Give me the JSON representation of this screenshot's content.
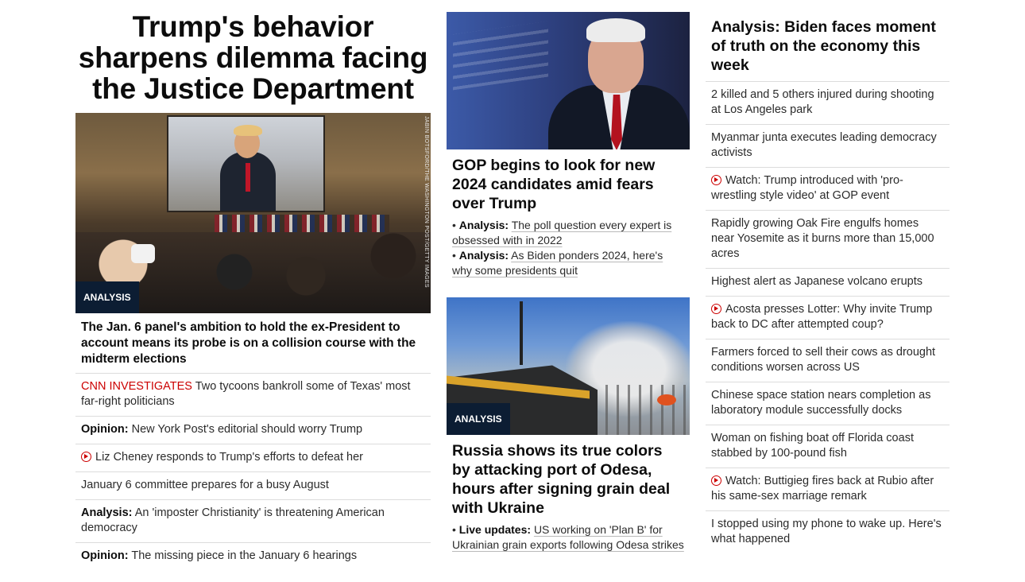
{
  "left": {
    "hero_title": "Trump's behavior sharpens dilemma facing the Justice Department",
    "image_credit": "JABIN BOTSFORD/THE WASHINGTON POST/GETTY IMAGES",
    "badge": "ANALYSIS",
    "card_headline": "The Jan. 6 panel's ambition to hold the ex-President to account means its probe is on a collision course with the midterm elections",
    "items": [
      {
        "tag": "CNN INVESTIGATES",
        "text": " Two tycoons bankroll some of Texas' most far-right politicians"
      },
      {
        "lead": "Opinion:",
        "text": " New York Post's editorial should worry Trump"
      },
      {
        "video": true,
        "text": "Liz Cheney responds to Trump's efforts to defeat her"
      },
      {
        "text": "January 6 committee prepares for a busy August"
      },
      {
        "lead": "Analysis:",
        "text": " An 'imposter Christianity' is threatening American democracy"
      },
      {
        "lead": "Opinion:",
        "text": " The missing piece in the January 6 hearings"
      }
    ]
  },
  "middle": {
    "story1": {
      "headline": "GOP begins to look for new 2024 candidates amid fears over Trump",
      "subs": [
        {
          "bullet": "• ",
          "lead": "Analysis:",
          "text": "The poll question every expert is obsessed with in 2022"
        },
        {
          "bullet": "• ",
          "lead": "Analysis:",
          "text": "As Biden ponders 2024, here's why some presidents quit"
        }
      ]
    },
    "story2": {
      "badge": "ANALYSIS",
      "headline": "Russia shows its true colors by attacking port of Odesa, hours after signing grain deal with Ukraine",
      "subs": [
        {
          "bullet": "• ",
          "lead": "Live updates:",
          "text": "US working on 'Plan B' for Ukrainian grain exports following Odesa strikes"
        }
      ]
    }
  },
  "right": {
    "headline": "Analysis: Biden faces moment of truth on the economy this week",
    "items": [
      {
        "text": "2 killed and 5 others injured during shooting at Los Angeles park"
      },
      {
        "text": "Myanmar junta executes leading democracy activists"
      },
      {
        "video": true,
        "text": "Watch: Trump introduced with 'pro-wrestling style video' at GOP event"
      },
      {
        "text": "Rapidly growing Oak Fire engulfs homes near Yosemite as it burns more than 15,000 acres"
      },
      {
        "text": "Highest alert as Japanese volcano erupts"
      },
      {
        "video": true,
        "text": "Acosta presses Lotter: Why invite Trump back to DC after attempted coup?"
      },
      {
        "text": "Farmers forced to sell their cows as drought conditions worsen across US"
      },
      {
        "text": "Chinese space station nears completion as laboratory module successfully docks"
      },
      {
        "text": "Woman on fishing boat off Florida coast stabbed by 100-pound fish"
      },
      {
        "video": true,
        "text": "Watch: Buttigieg fires back at Rubio after his same-sex marriage remark"
      },
      {
        "text": "I stopped using my phone to wake up. Here's what happened"
      }
    ]
  }
}
